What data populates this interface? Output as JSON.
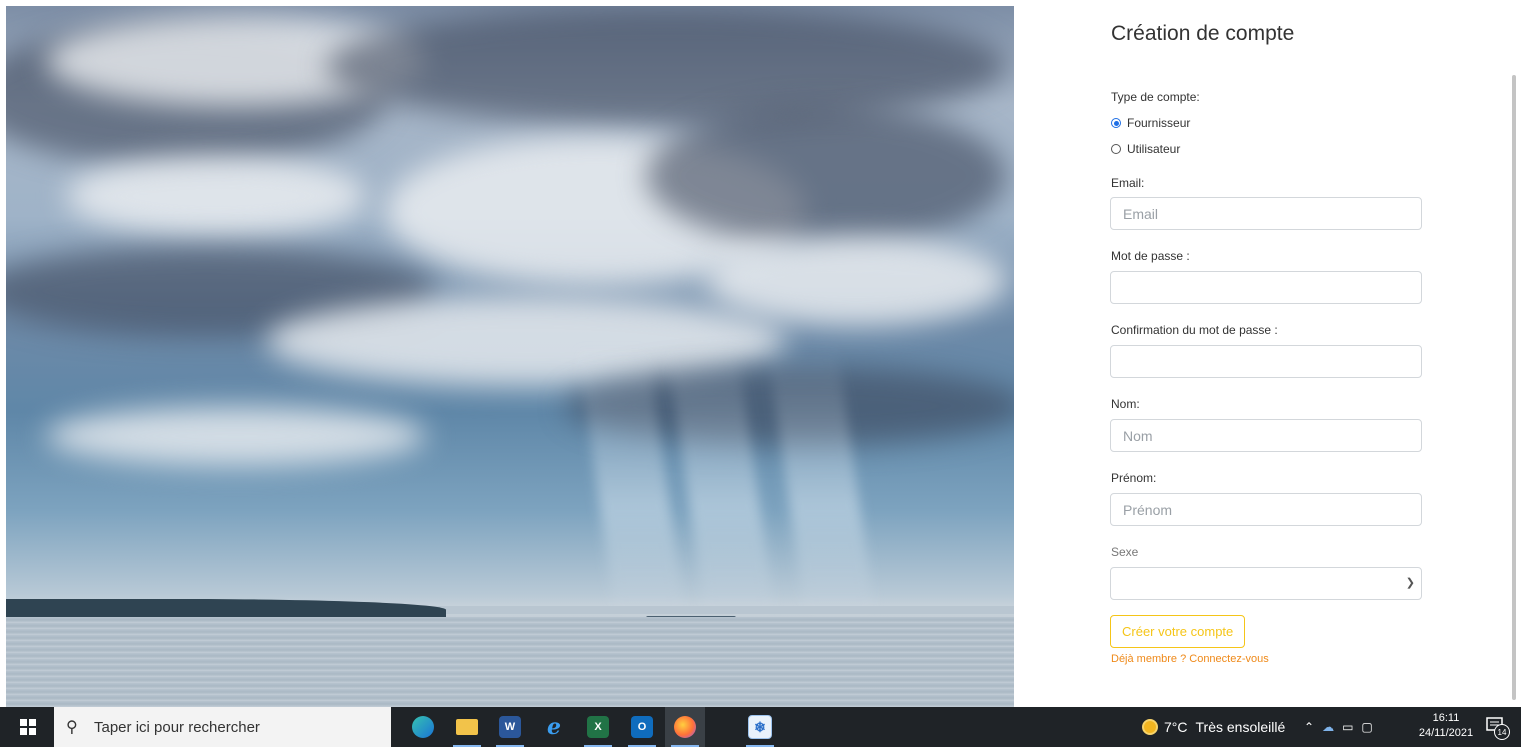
{
  "form": {
    "title": "Création de compte",
    "account_type_label": "Type de compte:",
    "account_types": [
      "Fournisseur",
      "Utilisateur"
    ],
    "selected_account_type": "Fournisseur",
    "email_label": "Email:",
    "email_placeholder": "Email",
    "password_label": "Mot de passe :",
    "password_confirm_label": "Confirmation du mot de passe :",
    "last_name_label": "Nom:",
    "last_name_placeholder": "Nom",
    "first_name_label": "Prénom:",
    "first_name_placeholder": "Prénom",
    "gender_label": "Sexe",
    "gender_value": "",
    "submit_label": "Créer votre compte",
    "login_link": "Déjà membre ? Connectez-vous"
  },
  "colors": {
    "accent_button": "#f5c518",
    "link": "#ef8a1a",
    "radio_checked": "#1f6fe5"
  },
  "taskbar": {
    "search_placeholder": "Taper ici pour rechercher",
    "apps": [
      "edge-icon",
      "file-explorer-icon",
      "word-icon",
      "internet-explorer-icon",
      "excel-icon",
      "outlook-icon",
      "firefox-icon",
      "snipping-tool-icon"
    ],
    "weather": {
      "temperature": "7°C",
      "condition": "Très ensoleillé"
    },
    "time": "16:11",
    "date": "24/11/2021",
    "notification_count": "14"
  }
}
